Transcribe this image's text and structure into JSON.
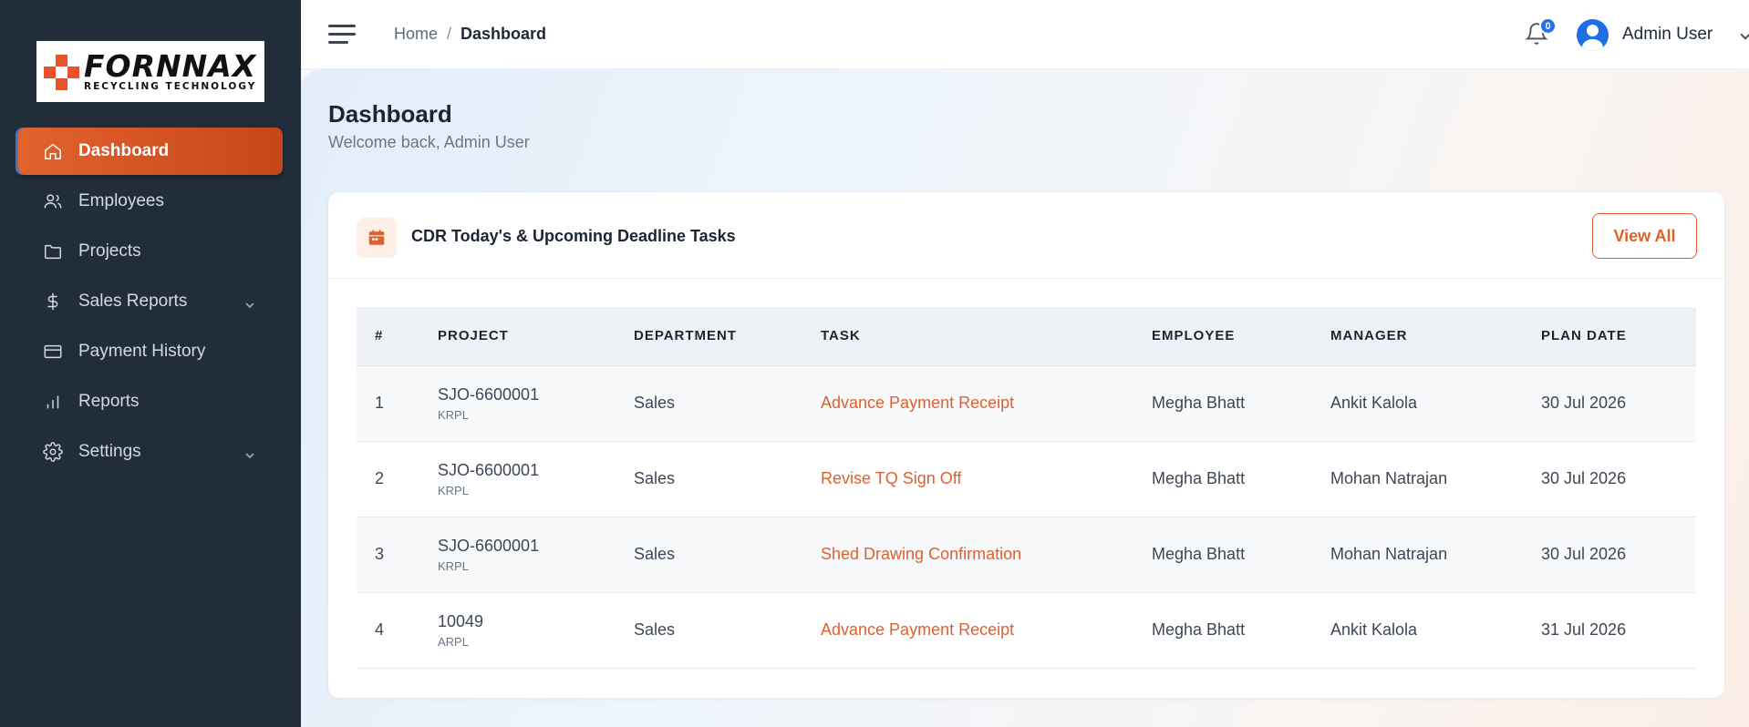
{
  "brand": {
    "logo_word": "FORNNAX",
    "logo_tagline": "RECYCLING TECHNOLOGY",
    "accent": "#e0602d"
  },
  "sidebar": {
    "items": [
      {
        "label": "Dashboard",
        "icon": "home-icon",
        "active": true
      },
      {
        "label": "Employees",
        "icon": "users-icon"
      },
      {
        "label": "Projects",
        "icon": "folder-icon"
      },
      {
        "label": "Sales Reports",
        "icon": "dollar-icon",
        "has_submenu": true
      },
      {
        "label": "Payment History",
        "icon": "credit-card-icon"
      },
      {
        "label": "Reports",
        "icon": "bar-chart-icon"
      },
      {
        "label": "Settings",
        "icon": "gear-icon",
        "has_submenu": true
      }
    ]
  },
  "topbar": {
    "breadcrumb": {
      "home": "Home",
      "separator": "/",
      "current": "Dashboard"
    },
    "notifications_count": "0",
    "user_name": "Admin User"
  },
  "page": {
    "title": "Dashboard",
    "subtitle": "Welcome back, Admin User"
  },
  "tasks_card": {
    "title": "CDR Today's & Upcoming Deadline Tasks",
    "view_all_label": "View All",
    "columns": [
      "#",
      "PROJECT",
      "DEPARTMENT",
      "TASK",
      "EMPLOYEE",
      "MANAGER",
      "PLAN DATE"
    ],
    "rows": [
      {
        "num": "1",
        "project": "SJO-6600001",
        "company": "KRPL",
        "department": "Sales",
        "task": "Advance Payment Receipt",
        "employee": "Megha Bhatt",
        "manager": "Ankit Kalola",
        "plan_date": "30 Jul 2026"
      },
      {
        "num": "2",
        "project": "SJO-6600001",
        "company": "KRPL",
        "department": "Sales",
        "task": "Revise TQ Sign Off",
        "employee": "Megha Bhatt",
        "manager": "Mohan Natrajan",
        "plan_date": "30 Jul 2026"
      },
      {
        "num": "3",
        "project": "SJO-6600001",
        "company": "KRPL",
        "department": "Sales",
        "task": "Shed Drawing Confirmation",
        "employee": "Megha Bhatt",
        "manager": "Mohan Natrajan",
        "plan_date": "30 Jul 2026"
      },
      {
        "num": "4",
        "project": "10049",
        "company": "ARPL",
        "department": "Sales",
        "task": "Advance Payment Receipt",
        "employee": "Megha Bhatt",
        "manager": "Ankit Kalola",
        "plan_date": "31 Jul 2026"
      }
    ]
  }
}
